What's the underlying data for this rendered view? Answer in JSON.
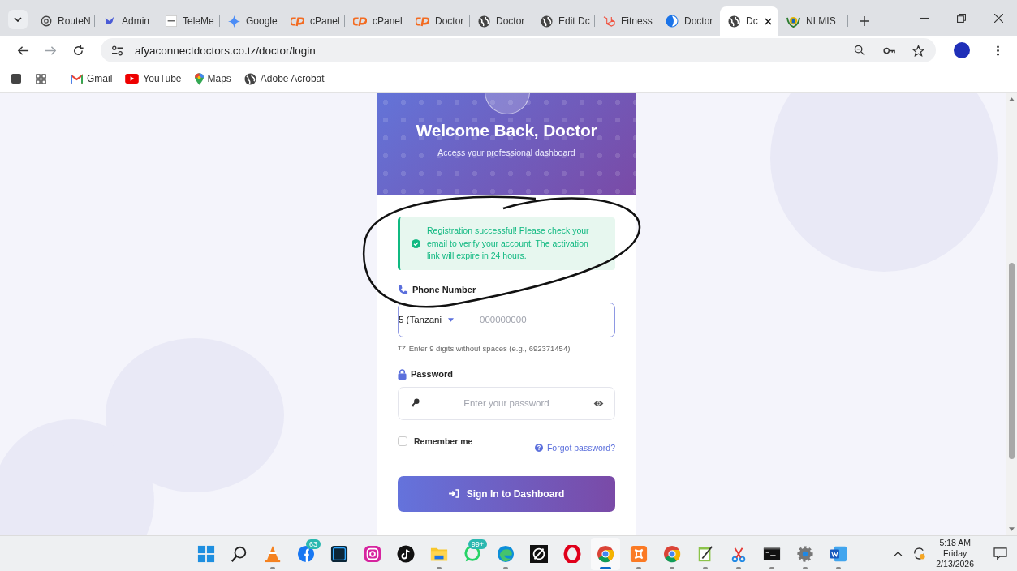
{
  "browser": {
    "tabs": [
      {
        "title": "RouteN",
        "kind": "swirl",
        "selected": false
      },
      {
        "title": "Admin",
        "kind": "bird",
        "selected": false
      },
      {
        "title": "TeleMe",
        "kind": "dash",
        "selected": false
      },
      {
        "title": "Google",
        "kind": "sparkle",
        "selected": false
      },
      {
        "title": "cPanel",
        "kind": "cpanel",
        "selected": false
      },
      {
        "title": "cPanel",
        "kind": "cpanel",
        "selected": false
      },
      {
        "title": "Doctor",
        "kind": "cpanel",
        "selected": false
      },
      {
        "title": "Doctor",
        "kind": "globe",
        "selected": false
      },
      {
        "title": "Edit Dc",
        "kind": "globe",
        "selected": false
      },
      {
        "title": "Fitness",
        "kind": "laravel",
        "selected": false
      },
      {
        "title": "Doctor",
        "kind": "halfmoon",
        "selected": false
      },
      {
        "title": "Dc",
        "kind": "globe",
        "selected": true
      },
      {
        "title": "NLMIS",
        "kind": "emblem",
        "selected": false
      }
    ],
    "address": "afyaconnectdoctors.co.tz/doctor/login",
    "bookmarks": [
      {
        "label": "Gmail",
        "kind": "gmail"
      },
      {
        "label": "YouTube",
        "kind": "youtube"
      },
      {
        "label": "Maps",
        "kind": "maps"
      },
      {
        "label": "Adobe Acrobat",
        "kind": "globe"
      }
    ]
  },
  "login": {
    "title": "Welcome Back, Doctor",
    "subtitle": "Access your professional dashboard",
    "alert": "Registration successful! Please check your email to verify your account. The activation link will expire in 24 hours.",
    "phone_label": "Phone Number",
    "country": "5 (Tanzani",
    "phone_placeholder": "000000000",
    "hint_flag": "TZ",
    "hint": "Enter 9 digits without spaces (e.g., 692371454)",
    "password_label": "Password",
    "password_placeholder": "Enter your password",
    "remember": {
      "label": "Remember me",
      "checked": false
    },
    "forgot": "Forgot password?",
    "submit": "Sign In to Dashboard"
  },
  "taskbar": {
    "apps": [
      {
        "kind": "start",
        "running": false,
        "selected": false
      },
      {
        "kind": "search",
        "running": false,
        "selected": false
      },
      {
        "kind": "vlc",
        "running": true,
        "selected": false
      },
      {
        "kind": "facebook",
        "running": false,
        "selected": false,
        "badge": "63"
      },
      {
        "kind": "photoshop",
        "running": false,
        "selected": false
      },
      {
        "kind": "instagram",
        "running": false,
        "selected": false
      },
      {
        "kind": "tiktok",
        "running": false,
        "selected": false
      },
      {
        "kind": "folder",
        "running": true,
        "selected": false
      },
      {
        "kind": "whatsapp",
        "running": false,
        "selected": false,
        "badge": "99+"
      },
      {
        "kind": "edge",
        "running": true,
        "selected": false
      },
      {
        "kind": "capcut",
        "running": false,
        "selected": false
      },
      {
        "kind": "opera",
        "running": false,
        "selected": false
      },
      {
        "kind": "chrome",
        "running": true,
        "selected": true
      },
      {
        "kind": "xampp",
        "running": true,
        "selected": false
      },
      {
        "kind": "chrome",
        "running": true,
        "selected": false
      },
      {
        "kind": "notepad",
        "running": true,
        "selected": false
      },
      {
        "kind": "snip",
        "running": true,
        "selected": false
      },
      {
        "kind": "terminal",
        "running": true,
        "selected": false
      },
      {
        "kind": "settings",
        "running": true,
        "selected": false
      },
      {
        "kind": "word",
        "running": true,
        "selected": false
      }
    ],
    "time": "5:18 AM",
    "day": "Friday",
    "date": "2/13/2026"
  }
}
